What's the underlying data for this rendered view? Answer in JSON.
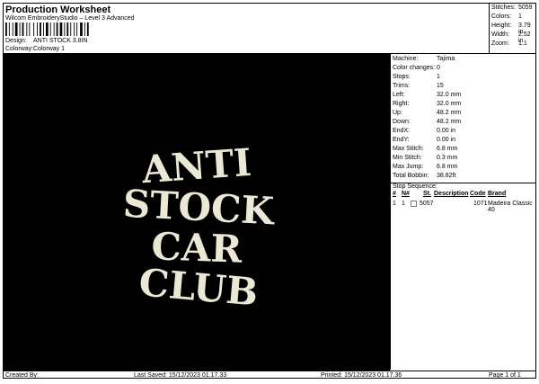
{
  "header": {
    "title": "Production Worksheet",
    "software": "Wilcom EmbroideryStudio – Level 3 Advanced",
    "design_label": "Design:",
    "design_value": "ANTI STOCK 3.8IN",
    "colorway_label": "Colorway:",
    "colorway_value": "Colorway 1"
  },
  "stats": [
    {
      "label": "Stitches:",
      "value": "5059"
    },
    {
      "label": "Colors:",
      "value": "1"
    },
    {
      "label": "Height:",
      "value": "3.79 in"
    },
    {
      "label": "Width:",
      "value": "2.52 in"
    },
    {
      "label": "Zoom:",
      "value": "1:1"
    }
  ],
  "design": {
    "lines": [
      "ANTI",
      "STOCK",
      "CAR",
      "CLUB"
    ],
    "thread_color": "#ece8d6",
    "background": "#000000"
  },
  "machine": [
    {
      "label": "Machine:",
      "value": "Tajima"
    },
    {
      "label": "Color changes:",
      "value": "0"
    },
    {
      "label": "Stops:",
      "value": "1"
    },
    {
      "label": "Trims:",
      "value": "15"
    },
    {
      "label": "Left:",
      "value": "32.0 mm"
    },
    {
      "label": "Right:",
      "value": "32.0 mm"
    },
    {
      "label": "Up:",
      "value": "48.2 mm"
    },
    {
      "label": "Down:",
      "value": "48.2 mm"
    },
    {
      "label": "EndX:",
      "value": "0.00 in"
    },
    {
      "label": "EndY:",
      "value": "0.00 in"
    },
    {
      "label": "Max Stitch:",
      "value": "6.8 mm"
    },
    {
      "label": "Min Stitch:",
      "value": "0.3 mm"
    },
    {
      "label": "Max Jump:",
      "value": "6.8 mm"
    },
    {
      "label": "Total Bobbin:",
      "value": "38.82ft"
    }
  ],
  "stop_sequence": {
    "title": "Stop Sequence:",
    "columns": [
      "#",
      "N#",
      "St.",
      "Description",
      "Code",
      "Brand"
    ],
    "rows": [
      {
        "num": "1",
        "n": "1",
        "stitches": "5057",
        "description": "",
        "code": "1071",
        "brand": "Madeira Classic 40"
      }
    ]
  },
  "footer": {
    "created_by": "Created By:",
    "last_saved": "Last Saved: 15/12/2023 01.17.33",
    "printed": "Printed: 15/12/2023 01.17.36",
    "page": "Page 1 of 1"
  }
}
